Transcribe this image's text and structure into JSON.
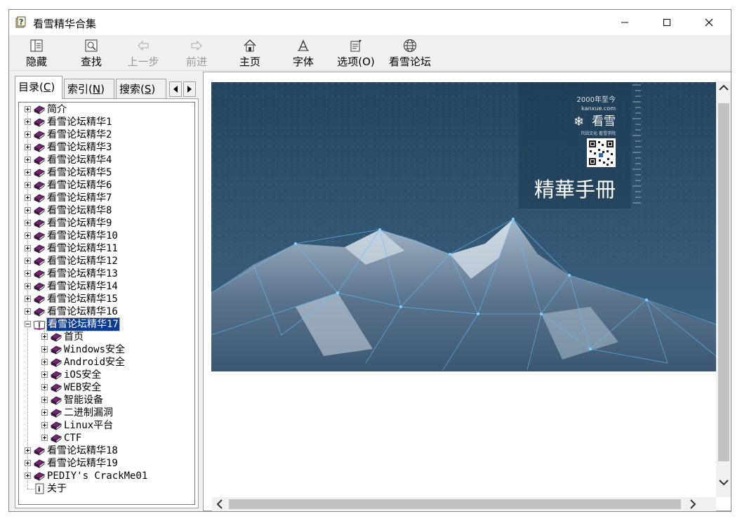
{
  "window": {
    "title": "看雪精华合集"
  },
  "toolbar": {
    "buttons": [
      {
        "label": "隐藏",
        "icon": "hide-icon",
        "enabled": true
      },
      {
        "label": "查找",
        "icon": "find-icon",
        "enabled": true
      },
      {
        "label": "上一步",
        "icon": "back-arrow-icon",
        "enabled": false
      },
      {
        "label": "前进",
        "icon": "forward-arrow-icon",
        "enabled": false
      },
      {
        "label": "主页",
        "icon": "home-icon",
        "enabled": true
      },
      {
        "label": "字体",
        "icon": "font-icon",
        "enabled": true
      },
      {
        "label": "选项(O)",
        "icon": "options-icon",
        "enabled": true
      },
      {
        "label": "看雪论坛",
        "icon": "globe-icon",
        "enabled": true
      }
    ]
  },
  "nav": {
    "tabs": [
      {
        "label": "目录(",
        "hotkey": "C",
        "suffix": ")",
        "active": true
      },
      {
        "label": "索引(",
        "hotkey": "N",
        "suffix": ")",
        "active": false
      },
      {
        "label": "搜索(",
        "hotkey": "S",
        "suffix": ")",
        "active": false
      }
    ],
    "tree": [
      {
        "label": "简介",
        "level": 0,
        "icon": "book-closed"
      },
      {
        "label": "看雪论坛精华1",
        "level": 0,
        "icon": "book-closed"
      },
      {
        "label": "看雪论坛精华2",
        "level": 0,
        "icon": "book-closed"
      },
      {
        "label": "看雪论坛精华3",
        "level": 0,
        "icon": "book-closed"
      },
      {
        "label": "看雪论坛精华4",
        "level": 0,
        "icon": "book-closed"
      },
      {
        "label": "看雪论坛精华5",
        "level": 0,
        "icon": "book-closed"
      },
      {
        "label": "看雪论坛精华6",
        "level": 0,
        "icon": "book-closed"
      },
      {
        "label": "看雪论坛精华7",
        "level": 0,
        "icon": "book-closed"
      },
      {
        "label": "看雪论坛精华8",
        "level": 0,
        "icon": "book-closed"
      },
      {
        "label": "看雪论坛精华9",
        "level": 0,
        "icon": "book-closed"
      },
      {
        "label": "看雪论坛精华10",
        "level": 0,
        "icon": "book-closed"
      },
      {
        "label": "看雪论坛精华11",
        "level": 0,
        "icon": "book-closed"
      },
      {
        "label": "看雪论坛精华12",
        "level": 0,
        "icon": "book-closed"
      },
      {
        "label": "看雪论坛精华13",
        "level": 0,
        "icon": "book-closed"
      },
      {
        "label": "看雪论坛精华14",
        "level": 0,
        "icon": "book-closed"
      },
      {
        "label": "看雪论坛精华15",
        "level": 0,
        "icon": "book-closed"
      },
      {
        "label": "看雪论坛精华16",
        "level": 0,
        "icon": "book-closed"
      },
      {
        "label": "看雪论坛精华17",
        "level": 0,
        "icon": "book-open",
        "expanded": true,
        "selected": true
      },
      {
        "label": "首页",
        "level": 1,
        "icon": "book-closed"
      },
      {
        "label": "Windows安全",
        "level": 1,
        "icon": "book-closed"
      },
      {
        "label": "Android安全",
        "level": 1,
        "icon": "book-closed"
      },
      {
        "label": "iOS安全",
        "level": 1,
        "icon": "book-closed"
      },
      {
        "label": "WEB安全",
        "level": 1,
        "icon": "book-closed"
      },
      {
        "label": "智能设备",
        "level": 1,
        "icon": "book-closed"
      },
      {
        "label": "二进制漏洞",
        "level": 1,
        "icon": "book-closed"
      },
      {
        "label": "Linux平台",
        "level": 1,
        "icon": "book-closed"
      },
      {
        "label": "CTF",
        "level": 1,
        "icon": "book-closed"
      },
      {
        "label": "看雪论坛精华18",
        "level": 0,
        "icon": "book-closed"
      },
      {
        "label": "看雪论坛精华19",
        "level": 0,
        "icon": "book-closed"
      },
      {
        "label": "PEDIY's CrackMe01",
        "level": 0,
        "icon": "book-closed"
      },
      {
        "label": "关于",
        "level": 0,
        "icon": "page",
        "leaf": true
      }
    ]
  },
  "content": {
    "banner": {
      "since_text": "2000年至今",
      "domain": "kanxue.com",
      "brand": "看雪",
      "slogan": "只因文化 看雪学院",
      "title": "精華手冊"
    }
  },
  "colors": {
    "selection": "#0a3c96",
    "book": "#7a1f7a",
    "banner_top": "#2a4a66",
    "banner_bottom": "#5f7f98"
  }
}
